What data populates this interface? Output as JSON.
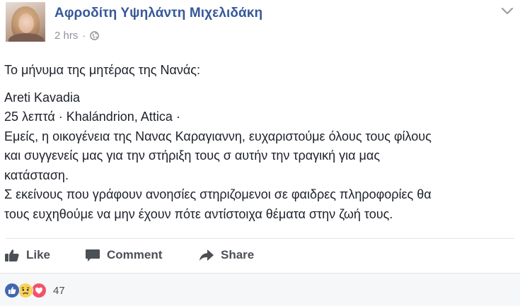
{
  "post": {
    "author": "Αφροδίτη Υψηλάντη Μιχελιδάκη",
    "time": "2 hrs",
    "separator": "·",
    "privacy_icon": "globe-icon",
    "menu_icon": "chevron-down-icon",
    "body_lines": [
      "Το μήνυμα της μητέρας της Νανάς:",
      "Areti Kavadia",
      "25 λεπτά · Khalándrion, Attica ·",
      "Εμείς, η οικογένεια της Νανας Καραγιαννη, ευχαριστούμε όλους τους φίλους",
      "και συγγενείς μας για την στήριξη τους σ αυτήν την τραγική για μας",
      "κατάσταση.",
      "Σ εκείνους που γράφουν ανοησίες στηριζομενοι σε φαιδρες πληροφορίες θα",
      "τους ευχηθούμε να μην έχουν πότε αντίστοιχα θέματα στην ζωή τους."
    ]
  },
  "actions": {
    "like": "Like",
    "comment": "Comment",
    "share": "Share"
  },
  "reactions": {
    "icons": [
      "like-reaction-icon",
      "sad-reaction-icon",
      "love-reaction-icon"
    ],
    "count": "47",
    "colors": {
      "like": "#4267b2",
      "sad": "#f7d35b",
      "love": "#f25268"
    }
  },
  "colors": {
    "author": "#365899",
    "meta": "#90949c",
    "text": "#1d2129",
    "action": "#4b4f56"
  }
}
